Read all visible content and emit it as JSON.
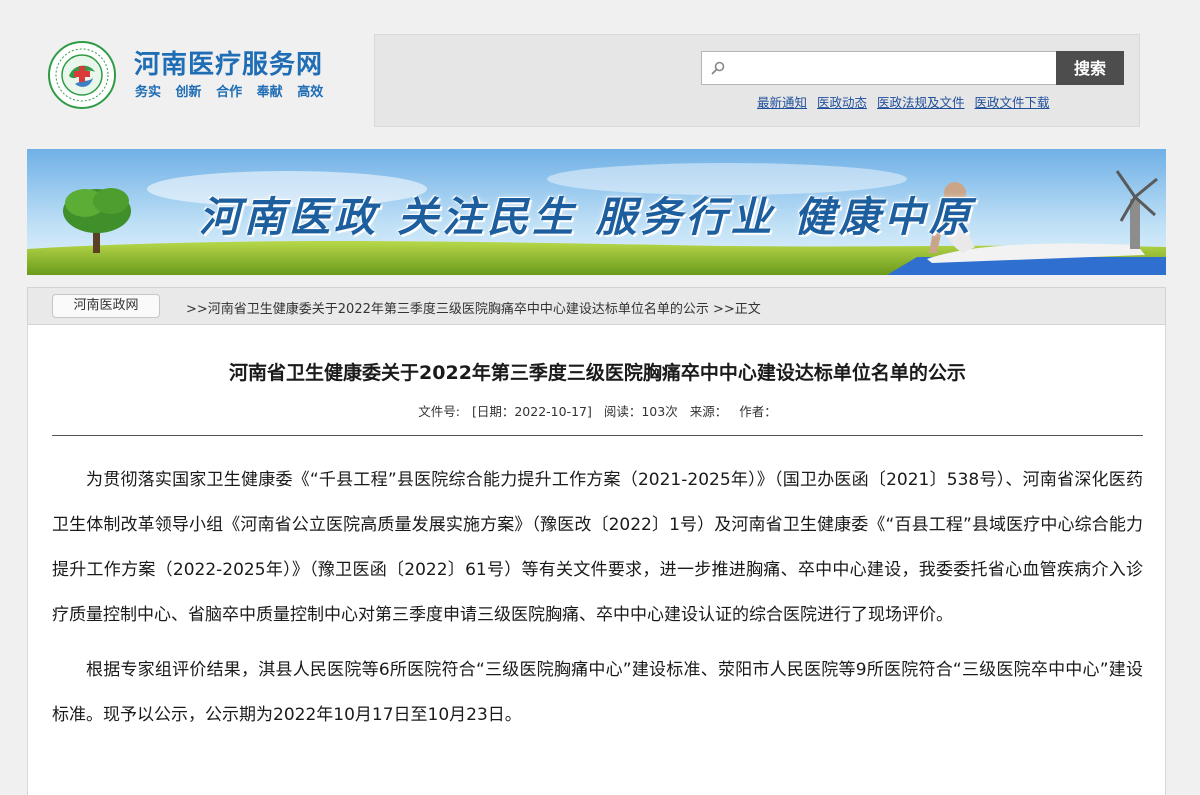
{
  "site": {
    "name": "河南医疗服务网",
    "slogan": [
      "务实",
      "创新",
      "合作",
      "奉献",
      "高效"
    ],
    "brand_color": "#1f6db5"
  },
  "search": {
    "value": "",
    "placeholder": "",
    "button_label": "搜索",
    "icon": "search-icon"
  },
  "quick_links": [
    "最新通知",
    "医政动态",
    "医政法规及文件",
    "医政文件下载"
  ],
  "banner": {
    "slogan": "河南医政  关注民生  服务行业  健康中原"
  },
  "breadcrumb": {
    "home": "河南医政网",
    "path": ">>河南省卫生健康委关于2022年第三季度三级医院胸痛卒中中心建设达标单位名单的公示 >>正文"
  },
  "article": {
    "title": "河南省卫生健康委关于2022年第三季度三级医院胸痛卒中中心建设达标单位名单的公示",
    "meta": {
      "doc_no": "文件号:",
      "date": "[日期：2022-10-17]",
      "reads": "阅读：103次",
      "source": "来源：",
      "author": "作者："
    },
    "paragraphs": [
      "为贯彻落实国家卫生健康委《“千县工程”县医院综合能力提升工作方案（2021-2025年）》（国卫办医函〔2021〕538号）、河南省深化医药卫生体制改革领导小组《河南省公立医院高质量发展实施方案》（豫医改〔2022〕1号）及河南省卫生健康委《“百县工程”县域医疗中心综合能力提升工作方案（2022-2025年）》（豫卫医函〔2022〕61号）等有关文件要求，进一步推进胸痛、卒中中心建设，我委委托省心血管疾病介入诊疗质量控制中心、省脑卒中质量控制中心对第三季度申请三级医院胸痛、卒中中心建设认证的综合医院进行了现场评价。",
      "根据专家组评价结果，淇县人民医院等6所医院符合“三级医院胸痛中心”建设标准、荥阳市人民医院等9所医院符合“三级医院卒中中心”建设标准。现予以公示，公示期为2022年10月17日至10月23日。"
    ]
  }
}
